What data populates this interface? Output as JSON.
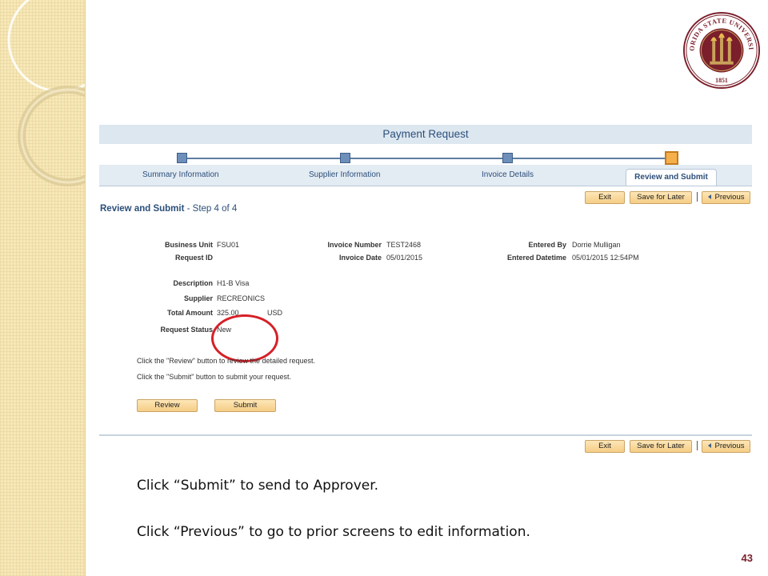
{
  "page_header": {
    "title": "Payment Request"
  },
  "steps": [
    {
      "label": "Summary Information",
      "state": "complete"
    },
    {
      "label": "Supplier Information",
      "state": "complete"
    },
    {
      "label": "Invoice Details",
      "state": "complete"
    },
    {
      "label": "Review and Submit",
      "state": "current"
    }
  ],
  "toolbar": {
    "exit": "Exit",
    "save_for_later": "Save for Later",
    "previous": "Previous"
  },
  "section": {
    "title": "Review and Submit",
    "subtitle": " - Step 4 of 4"
  },
  "fields": {
    "business_unit": {
      "label": "Business Unit",
      "value": "FSU01"
    },
    "request_id": {
      "label": "Request ID",
      "value": ""
    },
    "invoice_number": {
      "label": "Invoice Number",
      "value": "TEST2468"
    },
    "invoice_date": {
      "label": "Invoice Date",
      "value": "05/01/2015"
    },
    "entered_by": {
      "label": "Entered By",
      "value": "Dorrie Mulligan"
    },
    "entered_datetime": {
      "label": "Entered Datetime",
      "value": "05/01/2015 12:54PM"
    },
    "description": {
      "label": "Description",
      "value": "H1-B Visa"
    },
    "supplier": {
      "label": "Supplier",
      "value": "RECREONICS"
    },
    "total_amount": {
      "label": "Total Amount",
      "value": "325.00",
      "currency": "USD"
    },
    "request_status": {
      "label": "Request Status",
      "value": "New"
    }
  },
  "instructions": [
    "Click the \"Review\" button to review the detailed request.",
    "Click the \"Submit\" button to submit your request."
  ],
  "actions": {
    "review": "Review",
    "submit": "Submit"
  },
  "captions": [
    "Click “Submit” to send to Approver.",
    "Click “Previous” to go to prior screens to edit information."
  ],
  "slide_number": "43",
  "seal": {
    "text_top": "FLORIDA STATE UNIVERSITY",
    "year": "1851"
  },
  "colors": {
    "header_bg": "#dde7f0",
    "accent_blue": "#2c4f7a",
    "button_gold": "#f5cd85",
    "highlight_red": "#d62027",
    "garnet": "#7a1f2b"
  }
}
